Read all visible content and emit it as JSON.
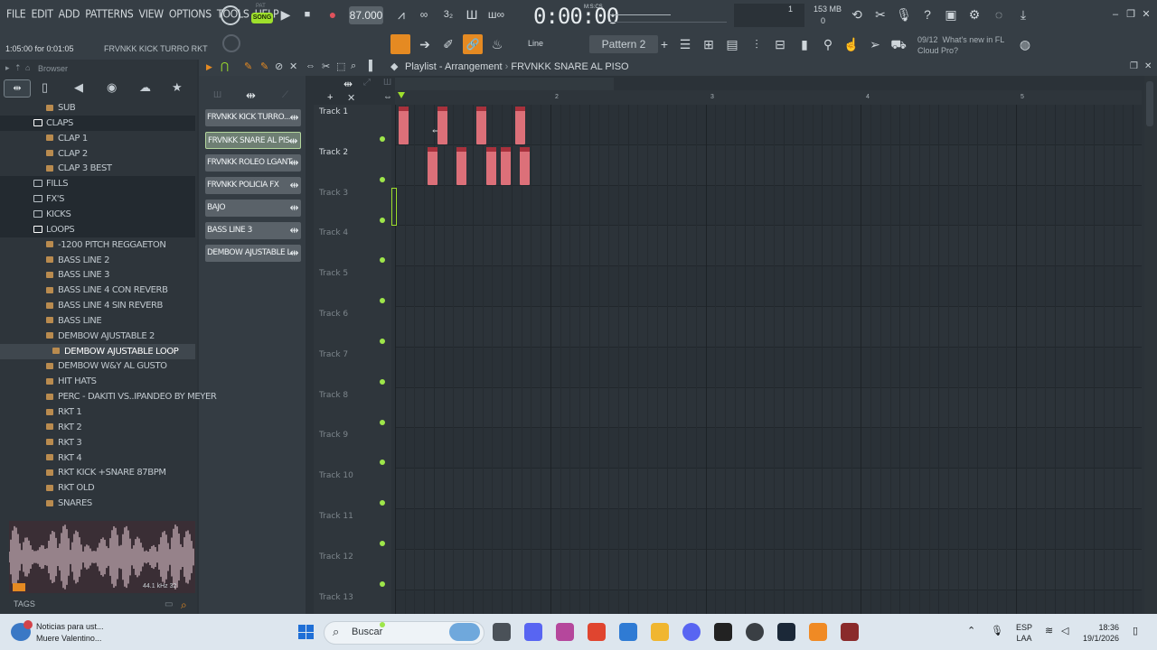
{
  "menu": [
    "FILE",
    "EDIT",
    "ADD",
    "PATTERNS",
    "VIEW",
    "OPTIONS",
    "TOOLS",
    "HELP"
  ],
  "transport": {
    "mode_label": "SONG",
    "pat_label": "PAT",
    "tempo": "87.000",
    "time": "0:00:00",
    "time_format": "M:S:CS",
    "cpu_value": "1",
    "memory": "153 MB",
    "memory_zero": "0"
  },
  "hint": {
    "text": "1:05:00 for 0:01:05",
    "name": "FRVNKK KICK TURRO RKT"
  },
  "toolbar2": {
    "snap_label": "Line",
    "pattern": "Pattern 2",
    "news_count": "09/12",
    "news_text_1": "What's new in FL",
    "news_text_2": "Cloud Pro?"
  },
  "browser": {
    "title": "Browser",
    "items": [
      {
        "label": "SUB",
        "type": "file",
        "indent": 1
      },
      {
        "label": "CLAPS",
        "type": "folder",
        "indent": 0,
        "open": true
      },
      {
        "label": "CLAP 1",
        "type": "file",
        "indent": 1
      },
      {
        "label": "CLAP 2",
        "type": "file",
        "indent": 1
      },
      {
        "label": "CLAP 3 BEST",
        "type": "file",
        "indent": 1
      },
      {
        "label": "FILLS",
        "type": "folder",
        "indent": 0
      },
      {
        "label": "FX'S",
        "type": "folder",
        "indent": 0
      },
      {
        "label": "KICKS",
        "type": "folder",
        "indent": 0
      },
      {
        "label": "LOOPS",
        "type": "folder",
        "indent": 0,
        "open": true
      },
      {
        "label": "-1200 PITCH REGGAETON",
        "type": "file",
        "indent": 1
      },
      {
        "label": "BASS LINE 2",
        "type": "file",
        "indent": 1
      },
      {
        "label": "BASS LINE 3",
        "type": "file",
        "indent": 1
      },
      {
        "label": "BASS LINE 4 CON REVERB",
        "type": "file",
        "indent": 1
      },
      {
        "label": "BASS LINE 4 SIN REVERB",
        "type": "file",
        "indent": 1
      },
      {
        "label": "BASS LINE",
        "type": "file",
        "indent": 1
      },
      {
        "label": "DEMBOW AJUSTABLE 2",
        "type": "file",
        "indent": 1
      },
      {
        "label": "DEMBOW AJUSTABLE LOOP",
        "type": "file",
        "indent": 1,
        "selected": true
      },
      {
        "label": "DEMBOW W&Y AL GUSTO",
        "type": "file",
        "indent": 1
      },
      {
        "label": "HIT HATS",
        "type": "file",
        "indent": 1
      },
      {
        "label": "PERC - DAKITI VS..IPANDEO BY MEYER",
        "type": "file",
        "indent": 1
      },
      {
        "label": "RKT 1",
        "type": "file",
        "indent": 1
      },
      {
        "label": "RKT 2",
        "type": "file",
        "indent": 1
      },
      {
        "label": "RKT 3",
        "type": "file",
        "indent": 1
      },
      {
        "label": "RKT 4",
        "type": "file",
        "indent": 1
      },
      {
        "label": "RKT KICK +SNARE 87BPM",
        "type": "file",
        "indent": 1
      },
      {
        "label": "RKT OLD",
        "type": "file",
        "indent": 1
      },
      {
        "label": "SNARES",
        "type": "file",
        "indent": 1
      }
    ],
    "waveform_info": "44.1 kHz 32",
    "tags_label": "TAGS"
  },
  "channels": [
    {
      "label": "FRVNKK KICK TURRO...",
      "selected": false
    },
    {
      "label": "FRVNKK SNARE AL PIS...",
      "selected": true
    },
    {
      "label": "FRVNKK ROLEO LGANT...",
      "selected": false
    },
    {
      "label": "FRVNKK POLICIA FX",
      "selected": false
    },
    {
      "label": "BAJO",
      "selected": false
    },
    {
      "label": "BASS LINE 3",
      "selected": false
    },
    {
      "label": "DEMBOW AJUSTABLE L...",
      "selected": false
    }
  ],
  "playlist": {
    "title": "Playlist - Arrangement",
    "current_pattern": "FRVNKK SNARE AL PISO",
    "bars": [
      "2",
      "3",
      "4",
      "5"
    ],
    "tracks": [
      "Track 1",
      "Track 2",
      "Track 3",
      "Track 4",
      "Track 5",
      "Track 6",
      "Track 7",
      "Track 8",
      "Track 9",
      "Track 10",
      "Track 11",
      "Track 12",
      "Track 13"
    ],
    "clips": [
      {
        "track": 1,
        "start_beat": 0.0
      },
      {
        "track": 1,
        "start_beat": 1.0
      },
      {
        "track": 1,
        "start_beat": 2.0
      },
      {
        "track": 1,
        "start_beat": 3.0
      },
      {
        "track": 2,
        "start_beat": 0.75
      },
      {
        "track": 2,
        "start_beat": 1.5
      },
      {
        "track": 2,
        "start_beat": 2.25
      },
      {
        "track": 2,
        "start_beat": 2.625
      },
      {
        "track": 2,
        "start_beat": 3.125
      }
    ]
  },
  "taskbar": {
    "news_title": "Noticias para ust...",
    "news_sub": "Muere Valentino...",
    "search_label": "Buscar",
    "lang_1": "ESP",
    "lang_2": "LAA",
    "time": "18:36",
    "date": "19/1/2026"
  }
}
